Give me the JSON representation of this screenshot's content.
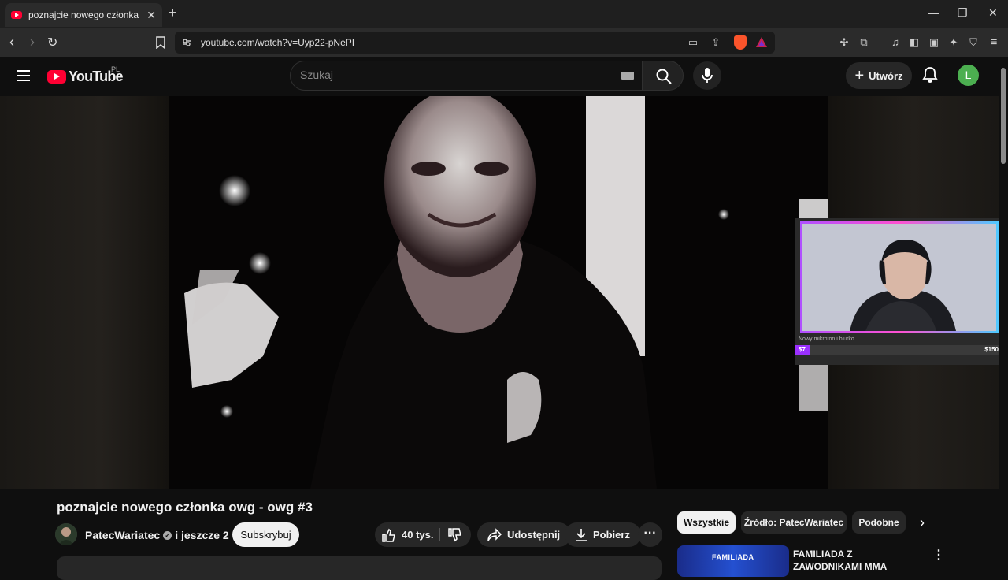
{
  "browser": {
    "tab_title": "poznajcie nowego członka owg",
    "url": "youtube.com/watch?v=Uyp22-pNePI"
  },
  "header": {
    "logo_text": "YouTube",
    "region": "PL",
    "search_placeholder": "Szukaj",
    "create_label": "Utwórz",
    "avatar_letter": "L"
  },
  "stream_overlay": {
    "goal_text": "Nowy mikrofon i biurko",
    "goal_current": "$7",
    "goal_target": "$150",
    "goal_progress": 0.047
  },
  "video": {
    "title": "poznajcie nowego członka owg - owg #3",
    "channel": "PatecWariatec",
    "channel_extra": "i jeszcze 2",
    "subscribe_label": "Subskrybuj",
    "likes": "40 tys.",
    "share_label": "Udostępnij",
    "download_label": "Pobierz"
  },
  "sidebar": {
    "chips": [
      "Wszystkie",
      "Źródło: PatecWariatec",
      "Podobne"
    ],
    "recommendations": [
      {
        "title": "FAMILIADA Z ZAWODNIKAMI MMA",
        "thumb_text": "FAMILIADA"
      }
    ]
  },
  "colors": {
    "brand": "#ff0033",
    "background": "#0f0f0f",
    "avatar": "#4caf50",
    "goal_fill": "#9b30ff"
  }
}
